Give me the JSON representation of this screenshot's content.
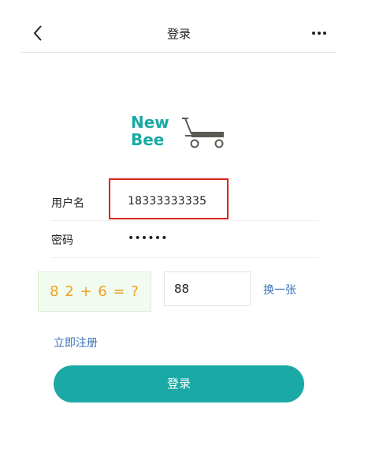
{
  "header": {
    "title": "登录"
  },
  "logo": {
    "line1": "New",
    "line2": "Bee",
    "brand_color": "#1aa9a4",
    "cart_color": "#5a5a55"
  },
  "form": {
    "username_label": "用户名",
    "username_value": "18333333335",
    "password_label": "密码",
    "password_value": "••••••"
  },
  "captcha": {
    "image_text": "8 2 + 6 = ?",
    "input_value": "88",
    "refresh_label": "换一张"
  },
  "register_link": "立即注册",
  "login_button": "登录",
  "colors": {
    "accent": "#1aa9a4",
    "link": "#3c72b8",
    "highlight_border": "#d9251d",
    "captcha_text": "#f0a022"
  }
}
